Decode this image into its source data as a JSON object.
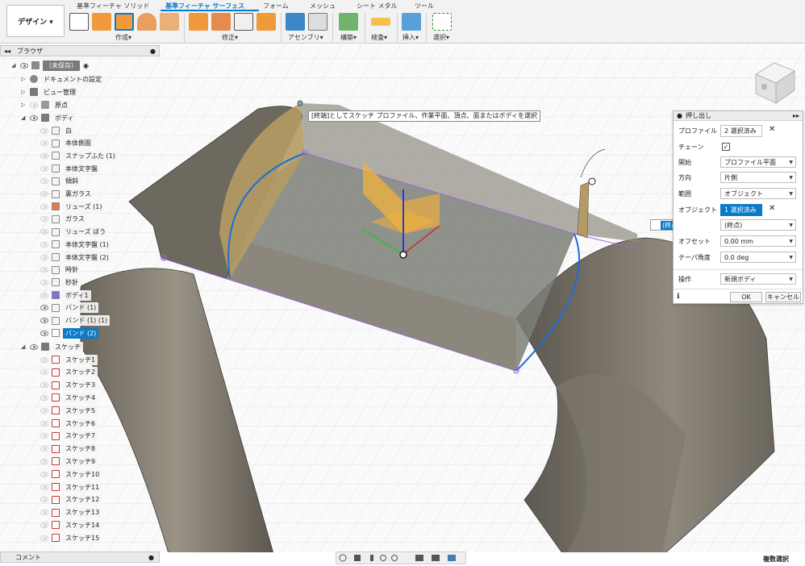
{
  "toolbar": {
    "workspace": "デザイン ▾",
    "tabs": [
      "基準フィーチャ ソリッド",
      "基準フィーチャ サーフェス",
      "フォーム",
      "メッシュ",
      "シート メタル",
      "ツール"
    ],
    "groups": [
      "作成▾",
      "修正▾",
      "アセンブリ▾",
      "構築▾",
      "検査▾",
      "挿入▾",
      "選択▾"
    ]
  },
  "browser": {
    "title": "ブラウザ",
    "root": "（未保存）",
    "doc_settings": "ドキュメントの設定",
    "view_mgmt": "ビュー管理",
    "origin": "原点",
    "bodies_folder": "ボディ",
    "bodies": [
      "白",
      "本体側面",
      "スナップふた (1)",
      "本体文字盤",
      "傾斜",
      "裏ガラス",
      "リューズ (1)",
      "ガラス",
      "リューズ ぼう",
      "本体文字盤 (1)",
      "本体文字盤 (2)",
      "時針",
      "秒針",
      "ボディ1",
      "バンド (1)",
      "バンド (1) (1)",
      "バンド (2)"
    ],
    "sketches_folder": "スケッチ",
    "sketches": [
      "スケッチ1",
      "スケッチ2",
      "スケッチ3",
      "スケッチ4",
      "スケッチ5",
      "スケッチ6",
      "スケッチ7",
      "スケッチ8",
      "スケッチ9",
      "スケッチ10",
      "スケッチ11",
      "スケッチ12",
      "スケッチ13",
      "スケッチ14",
      "スケッチ15"
    ]
  },
  "tooltip": "[終端]としてスケッチ プロファイル、作業平面、頂点、面またはボディを選択",
  "dialog": {
    "title": "押し出し",
    "profile_label": "プロファイル",
    "profile_value": "2 選択済み",
    "chain_label": "チェーン",
    "start_label": "開始",
    "start_value": "プロファイル平面",
    "direction_label": "方向",
    "direction_value": "片側",
    "extent_label": "範囲",
    "extent_value": "オブジェクト",
    "object_label": "オブジェクト",
    "object_value": "1 選択済み",
    "endpoint_value": "(終点)",
    "offset_label": "オフセット",
    "offset_value": "0.00 mm",
    "taper_label": "テーパ角度",
    "taper_value": "0.0 deg",
    "operation_label": "操作",
    "operation_value": "新規ボディ",
    "ok": "OK",
    "cancel": "キャンセル"
  },
  "endpoint_field": "(終点)",
  "comment": "コメント",
  "status": "複数選択",
  "viewcube_label": "前"
}
